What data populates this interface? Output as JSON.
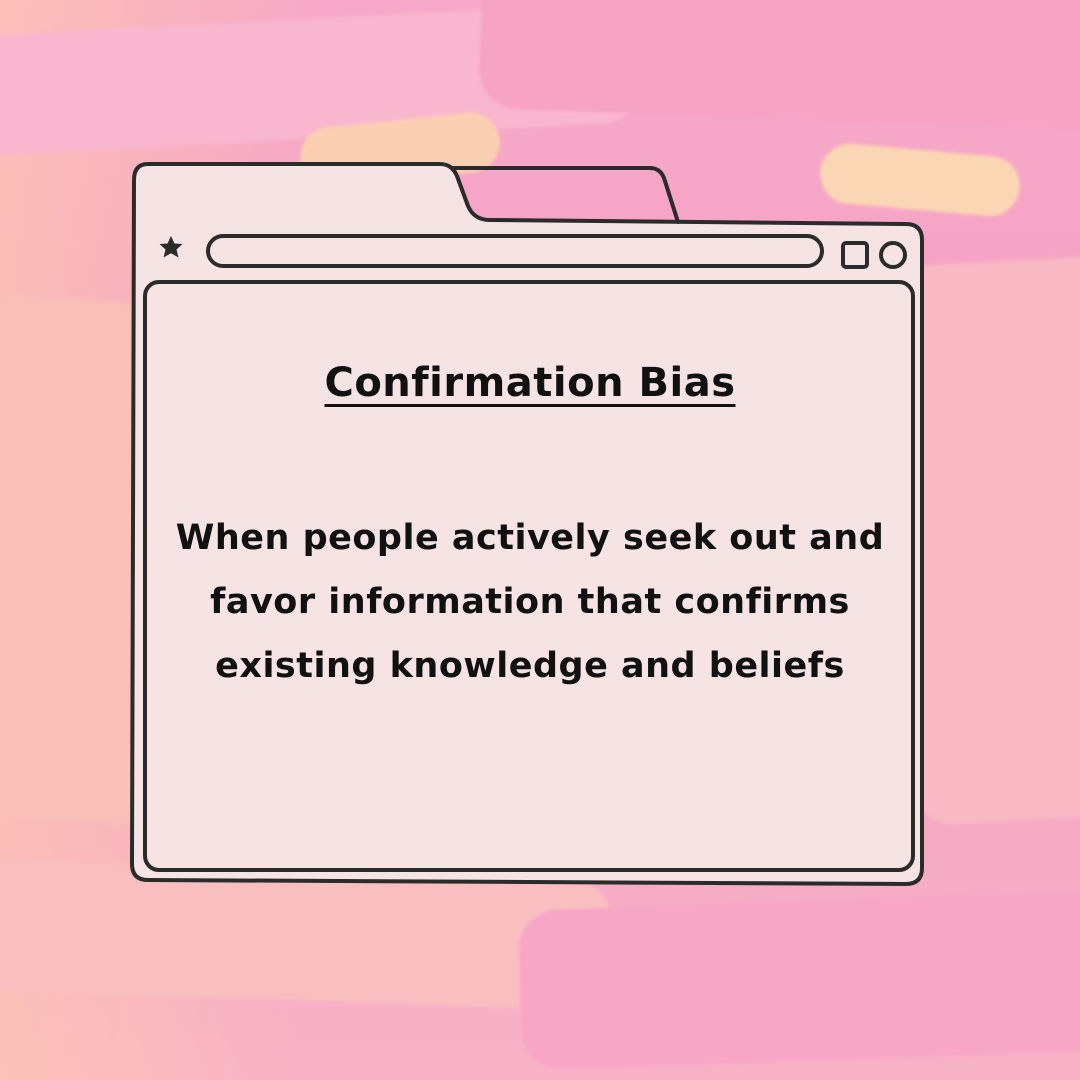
{
  "colors": {
    "window_fill": "#f6e3e3",
    "outline": "#2b2b2b",
    "text": "#111111"
  },
  "toolbar": {
    "bookmark_icon": "star-icon",
    "maximize_icon": "square-icon",
    "close_icon": "circle-icon"
  },
  "card": {
    "title": "Confirmation Bias",
    "description": "When people actively seek out and favor information that confirms existing knowledge and beliefs"
  }
}
